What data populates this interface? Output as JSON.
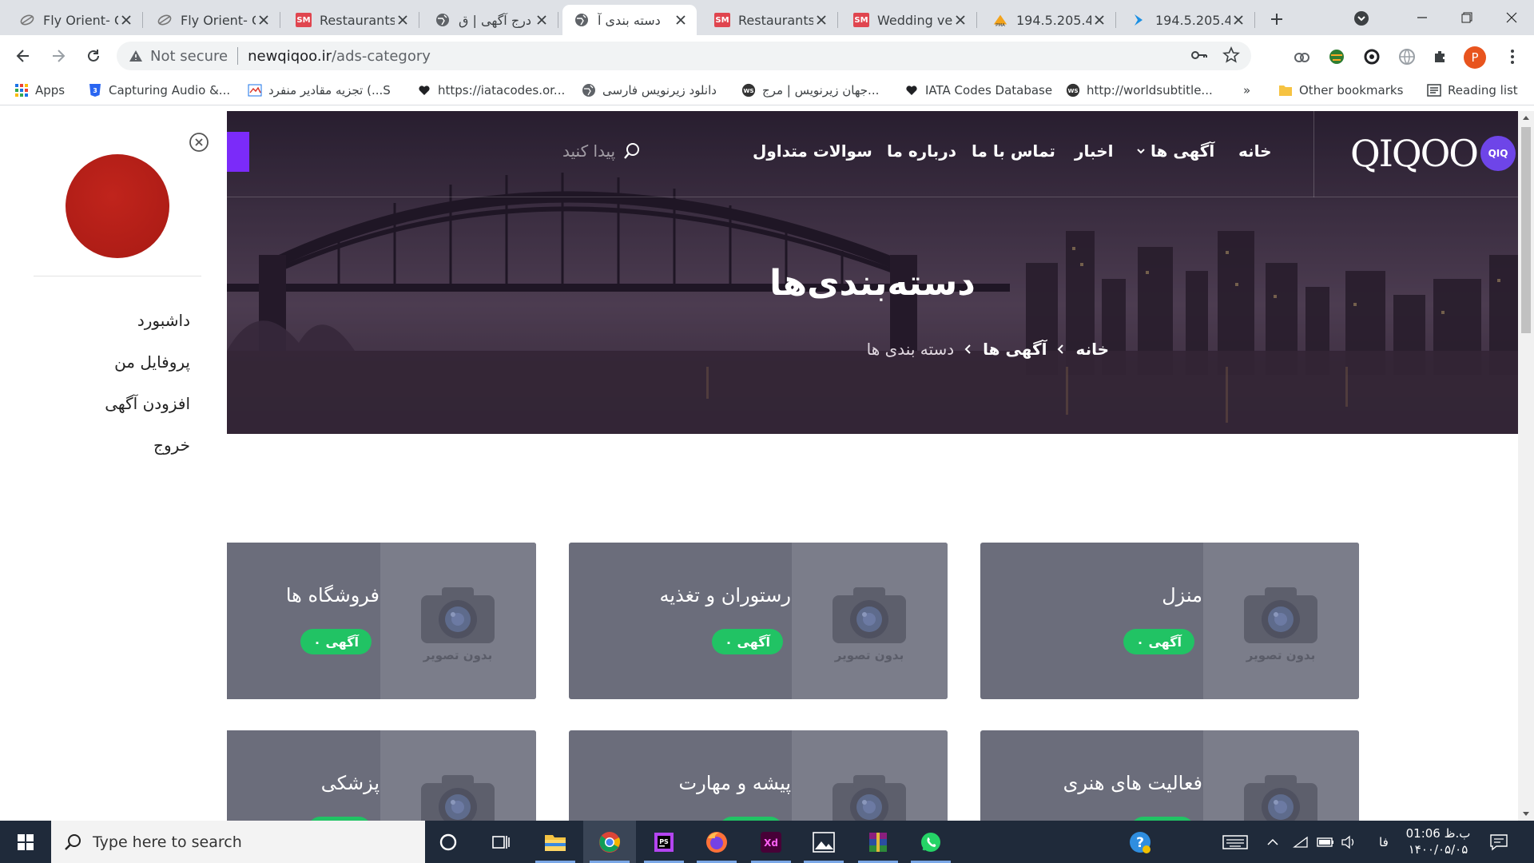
{
  "browser": {
    "tabs": [
      {
        "title": "Fly Orient- C",
        "icon": "plane-icon"
      },
      {
        "title": "Fly Orient- C",
        "icon": "plane-icon"
      },
      {
        "title": "Restaurants",
        "icon": "sm-icon"
      },
      {
        "title": "درج آگهی | ق",
        "icon": "globe-icon"
      },
      {
        "title": "دسته بندی آ",
        "icon": "globe-icon",
        "active": true
      },
      {
        "title": "Restaurants",
        "icon": "sm-icon"
      },
      {
        "title": "Wedding ve",
        "icon": "sm-icon"
      },
      {
        "title": "194.5.205.4",
        "icon": "pma-icon"
      },
      {
        "title": "194.5.205.4",
        "icon": "arrow-icon"
      }
    ],
    "sm_label": "SM",
    "security": "Not secure",
    "url_host": "newqiqoo.ir",
    "url_path": "/ads-category",
    "profile_initial": "P",
    "bookmarks": [
      {
        "label": "Apps",
        "icon": "apps-grid-icon"
      },
      {
        "label": "Capturing Audio &...",
        "icon": "css3-icon"
      },
      {
        "label": "تجزیه مقادیر منفرد (...S",
        "icon": "bookmark-site-icon"
      },
      {
        "label": "https://iatacodes.or...",
        "icon": "heart-icon"
      },
      {
        "label": "دانلود زیرنویس فارسی",
        "icon": "globe-icon"
      },
      {
        "label": "جهان زیرنویس | مرج...",
        "icon": "ws-icon"
      },
      {
        "label": "IATA Codes Database",
        "icon": "heart-icon"
      },
      {
        "label": "http://worldsubtitle...",
        "icon": "ws-icon"
      }
    ],
    "overflow": "»",
    "other_bookmarks": "Other bookmarks",
    "reading_list": "Reading list"
  },
  "site": {
    "logo_text": "QIQOO",
    "logo_badge": "QIQ",
    "nav": {
      "home": "خانه",
      "ads": "آگهی ها",
      "news": "اخبار",
      "contact": "تماس با ما",
      "about": "درباره ما",
      "faq": "سوالات متداول"
    },
    "search_placeholder": "پیدا کنید",
    "hero_title": "دسته‌بندی‌ها",
    "breadcrumb": {
      "home": "خانه",
      "ads": "آگهی ها",
      "current": "دسته بندی ها"
    },
    "drawer": {
      "menu": [
        "داشبورد",
        "پروفایل من",
        "افزودن آگهی",
        "خروج"
      ]
    },
    "no_image_label": "بدون تصویر",
    "categories": [
      {
        "title": "منزل",
        "count": "۰ آگهی"
      },
      {
        "title": "رستوران و تغذیه",
        "count": "۰ آگهی"
      },
      {
        "title": "فروشگاه ها",
        "count": "۰ آگهی"
      },
      {
        "title": "فعالیت های هنری",
        "count": ""
      },
      {
        "title": "پیشه و مهارت",
        "count": ""
      },
      {
        "title": "پزشکی",
        "count": ""
      }
    ],
    "colors": {
      "accent": "#7b2bf9",
      "badge": "#21c364",
      "card": "#6b6d7b",
      "avatar": "#b3201a"
    }
  },
  "taskbar": {
    "search_placeholder": "Type here to search",
    "apps": [
      "cortana-icon",
      "task-view-icon",
      "file-explorer-icon",
      "chrome-icon",
      "phpstorm-icon",
      "firefox-icon",
      "adobe-xd-icon",
      "photos-icon",
      "winrar-icon",
      "whatsapp-icon"
    ],
    "lang": "فا",
    "time": "01:06 ب.ظ",
    "date": "۱۴۰۰/۰۵/۰۵"
  }
}
